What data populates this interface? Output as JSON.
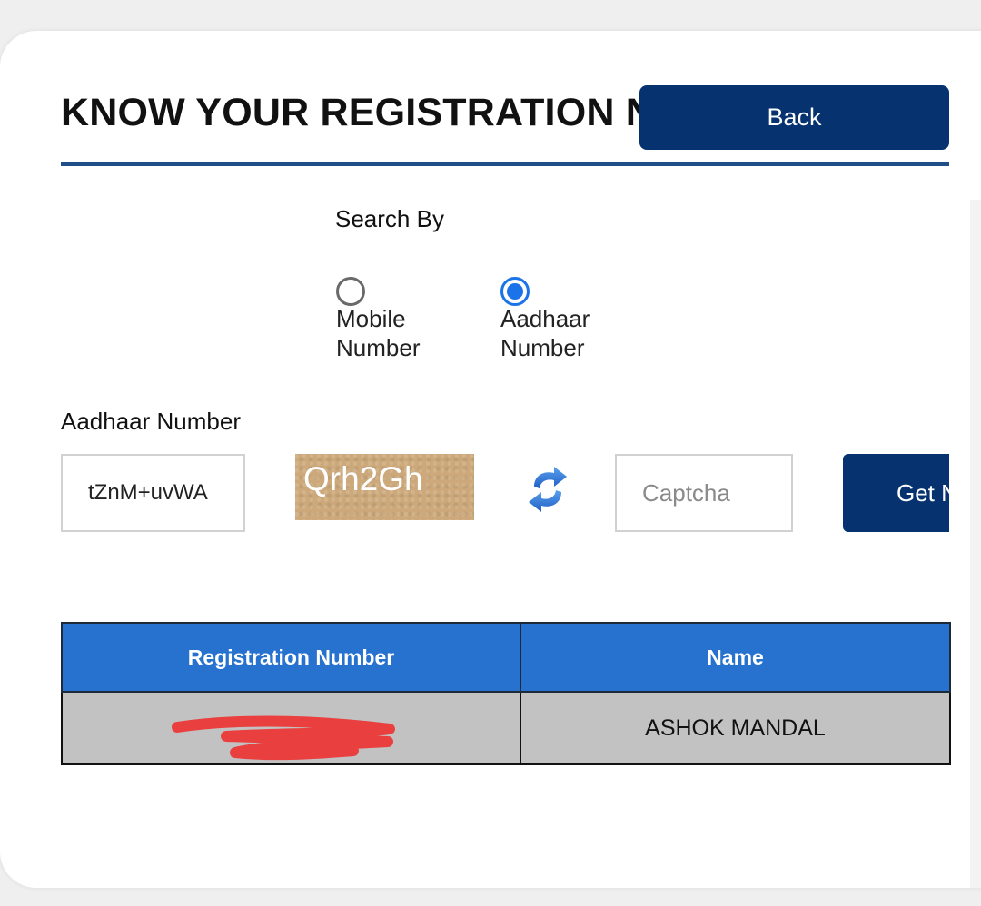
{
  "header": {
    "title": "KNOW YOUR REGISTRATION NUMBER",
    "back_label": "Back"
  },
  "search": {
    "search_by_label": "Search By",
    "options": [
      {
        "label": "Mobile Number",
        "selected": false
      },
      {
        "label": "Aadhaar Number",
        "selected": true
      }
    ],
    "field_label": "Aadhaar Number",
    "aadhaar_value": "tZnM+uvWA",
    "captcha_text": "Qrh2Gh",
    "captcha_placeholder": "Captcha",
    "submit_label": "Get Number",
    "refresh_icon": "refresh-icon"
  },
  "results": {
    "columns": [
      "Registration Number",
      "Name"
    ],
    "rows": [
      {
        "registration_number": "",
        "name": "ASHOK MANDAL"
      }
    ]
  },
  "colors": {
    "primary": "#063370",
    "table_header": "#2772cf",
    "radio_selected": "#1a73e8",
    "captcha_bg": "#cca87a",
    "redaction": "#ea3f3f"
  }
}
